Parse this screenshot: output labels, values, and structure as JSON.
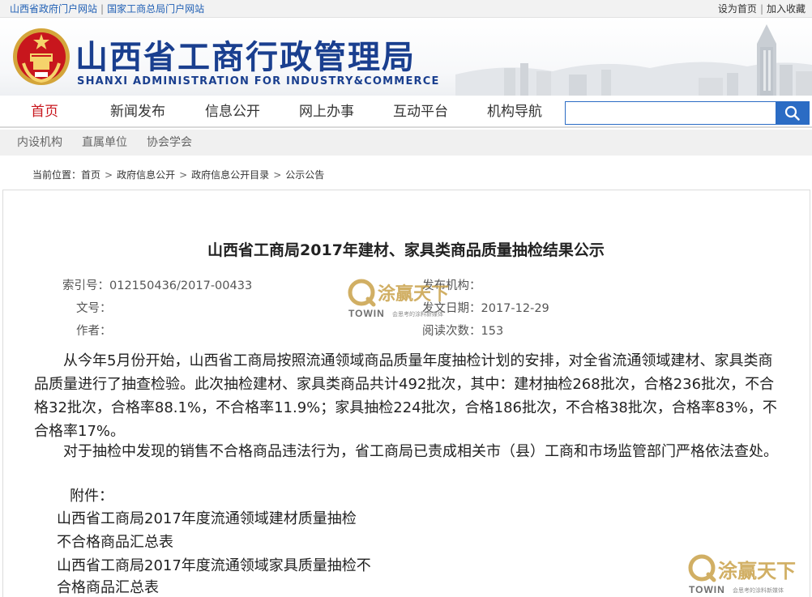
{
  "topbar": {
    "left_links": [
      "山西省政府门户网站",
      "国家工商总局门户网站"
    ],
    "right_links": [
      "设为首页",
      "加入收藏"
    ]
  },
  "header": {
    "title": "山西省工商行政管理局",
    "subtitle": "SHANXI ADMINISTRATION FOR INDUSTRY&COMMERCE"
  },
  "nav": {
    "items": [
      "首页",
      "新闻发布",
      "信息公开",
      "网上办事",
      "互动平台",
      "机构导航"
    ],
    "active_index": 0,
    "search_placeholder": ""
  },
  "subnav": {
    "items": [
      "内设机构",
      "直属单位",
      "协会学会"
    ]
  },
  "breadcrumb": {
    "label": "当前位置：",
    "items": [
      "首页",
      "政府信息公开",
      "政府信息公开目录",
      "公示公告"
    ],
    "separator": ">"
  },
  "article": {
    "title": "山西省工商局2017年建材、家具类商品质量抽检结果公示",
    "meta": {
      "index_label": "索引号：",
      "index_value": "012150436/2017-00433",
      "doc_label": "文号：",
      "doc_value": "",
      "author_label": "作者：",
      "author_value": "",
      "publisher_label": "发布机构：",
      "publisher_value": "",
      "date_label": "发文日期：",
      "date_value": "2017-12-29",
      "reads_label": "阅读次数：",
      "reads_value": "153"
    },
    "paragraphs": [
      "　　从今年5月份开始，山西省工商局按照流通领域商品质量年度抽检计划的安排，对全省流通领域建材、家具类商品质量进行了抽查检验。此次抽检建材、家具类商品共计492批次，其中：建材抽检268批次，合格236批次，不合格32批次，合格率88.1%，不合格率11.9%；家具抽检224批次，合格186批次，不合格38批次，合格率83%，不合格率17%。",
      "　　对于抽检中发现的销售不合格商品违法行为，省工商局已责成相关市（县）工商和市场监管部门严格依法查处。"
    ],
    "attachment_label": "附件：",
    "attachments": [
      "山西省工商局2017年度流通领域建材质量抽检",
      "不合格商品汇总表",
      "山西省工商局2017年度流通领域家具质量抽检不",
      "合格商品汇总表"
    ]
  },
  "watermark": {
    "name": "涂赢天下",
    "latin": "TOWIN",
    "tagline": "会思考的涂料新媒体"
  },
  "colors": {
    "brand_blue": "#1a3f8f",
    "link_blue": "#1f5fb4",
    "active_red": "#c8161d",
    "search_blue": "#2b6cc4"
  }
}
